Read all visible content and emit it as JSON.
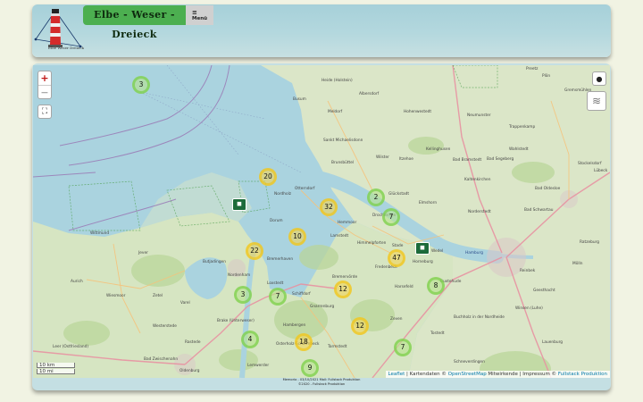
{
  "header": {
    "title": "Elbe - Weser - Dreieck",
    "menu_label": "Menü",
    "logo_text": "Elbe Weser Dreieck"
  },
  "map": {
    "controls": {
      "zoom_in": "+",
      "zoom_out": "−",
      "fullscreen_icon": "fullscreen-icon",
      "locate_icon": "location-pin-icon",
      "layers_icon": "layers-icon"
    },
    "scale": {
      "metric": "10 km",
      "imperial": "10 mi"
    },
    "attribution": {
      "leaflet": "Leaflet",
      "sep1": " | Kartendaten © ",
      "osm": "OpenStreetMap",
      "sep2": " Mitwirkende | Impressum © ",
      "fullstack": "Fullstack Produktion"
    },
    "clusters": [
      {
        "count": "3",
        "color": "green"
      },
      {
        "count": "20",
        "color": "yellow"
      },
      {
        "count": "32",
        "color": "yellow"
      },
      {
        "count": "2",
        "color": "green"
      },
      {
        "count": "7",
        "color": "green"
      },
      {
        "count": "10",
        "color": "yellow"
      },
      {
        "count": "22",
        "color": "yellow"
      },
      {
        "count": "47",
        "color": "yellow"
      },
      {
        "count": "8",
        "color": "green"
      },
      {
        "count": "3",
        "color": "green"
      },
      {
        "count": "7",
        "color": "green"
      },
      {
        "count": "12",
        "color": "yellow"
      },
      {
        "count": "12",
        "color": "yellow"
      },
      {
        "count": "4",
        "color": "green"
      },
      {
        "count": "18",
        "color": "yellow"
      },
      {
        "count": "7",
        "color": "green"
      },
      {
        "count": "9",
        "color": "green"
      }
    ],
    "place_labels": [
      "Heide (Holstein)",
      "Albersdorf",
      "Preetz",
      "Busum",
      "Meldorf",
      "Hohenwestedt",
      "Neumunster",
      "Plön",
      "Gremsmühlen",
      "Trappenkamp",
      "Bad Segeberg",
      "Sankt Michaelisdonn",
      "Bad Bramstedt",
      "Wahlstedt",
      "Kellinghusen",
      "Brunsbüttel",
      "Glückstadt",
      "Wilster",
      "Itzehoe",
      "Kaltenkirchen",
      "Bad Oldesloe",
      "Stockelsdorf",
      "Lübeck",
      "Otterndorf",
      "Hemmoor",
      "Drochtersen",
      "Elmshorn",
      "Norderstedt",
      "Bad Schwartau",
      "Nordholz",
      "Dorum",
      "Lamstedt",
      "Stade",
      "Wedel",
      "Hamburg",
      "Reinbek",
      "Geesthacht",
      "Ratzeburg",
      "Mölln",
      "Himmelpforten",
      "Fredenbeck",
      "Horneburg",
      "Buxtehude",
      "Harsefeld",
      "Winsen (Luhe)",
      "Lauenburg",
      "Bremerhaven",
      "Loxstedt",
      "Schiffdorf",
      "Bremervörde",
      "Butjadingen",
      "Nordenham",
      "Brake (Unterweser)",
      "Hambergen",
      "Gnarrenburg",
      "Zeven",
      "Tostedt",
      "Buchholz in der Nordheide",
      "Jever",
      "Wittmund",
      "Aurich",
      "Wiesmoor",
      "Zetel",
      "Varel",
      "Westerstede",
      "Rastede",
      "Leer (Ostfriesland)",
      "Bad Zwischenahn",
      "Oldenburg",
      "Lemwerder",
      "Osterholz-Scharmbeck",
      "Tarmstedt",
      "Schneverdingen"
    ],
    "footer_line1": "Memorio - 03/10/2021 Mail: Fullstack Produktion",
    "footer_line2": "©2020 - Fullstack Produktion"
  }
}
